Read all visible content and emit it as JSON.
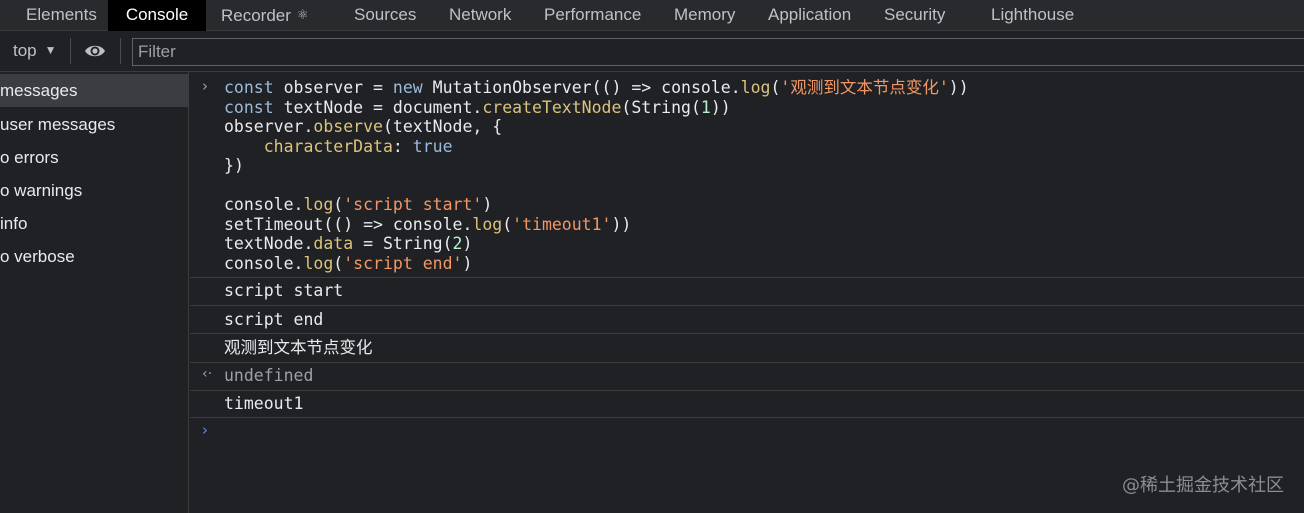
{
  "tabs": [
    {
      "label": "Elements",
      "active": false
    },
    {
      "label": "Console",
      "active": true
    },
    {
      "label": "Recorder",
      "active": false
    },
    {
      "label": "Sources",
      "active": false
    },
    {
      "label": "Network",
      "active": false
    },
    {
      "label": "Performance",
      "active": false
    },
    {
      "label": "Memory",
      "active": false
    },
    {
      "label": "Application",
      "active": false
    },
    {
      "label": "Security",
      "active": false
    },
    {
      "label": "Lighthouse",
      "active": false
    }
  ],
  "recorder_icon": "flask-icon",
  "toolbar": {
    "context": "top",
    "filter_placeholder": "Filter"
  },
  "sidebar": {
    "items": [
      {
        "label": "messages",
        "selected": true
      },
      {
        "label": "user messages",
        "selected": false
      },
      {
        "label": "o errors",
        "selected": false
      },
      {
        "label": "o warnings",
        "selected": false
      },
      {
        "label": "info",
        "selected": false
      },
      {
        "label": "o verbose",
        "selected": false
      }
    ]
  },
  "code": {
    "lines": [
      "const observer = new MutationObserver(() => console.log('观测到文本节点变化'))",
      "const textNode = document.createTextNode(String(1))",
      "observer.observe(textNode, {",
      "    characterData: true",
      "})",
      "",
      "console.log('script start')",
      "setTimeout(() => console.log('timeout1'))",
      "textNode.data = String(2)",
      "console.log('script end')"
    ]
  },
  "outputs": [
    {
      "text": "script start"
    },
    {
      "text": "script end"
    },
    {
      "text": "观测到文本节点变化"
    },
    {
      "text": "undefined"
    },
    {
      "text": "timeout1"
    }
  ],
  "watermark": "@稀土掘金技术社区",
  "colors": {
    "background": "#202124",
    "keyword": "#9bbbdc",
    "function": "#dbc37d",
    "string": "#f29766",
    "number": "#b6f2cc"
  }
}
